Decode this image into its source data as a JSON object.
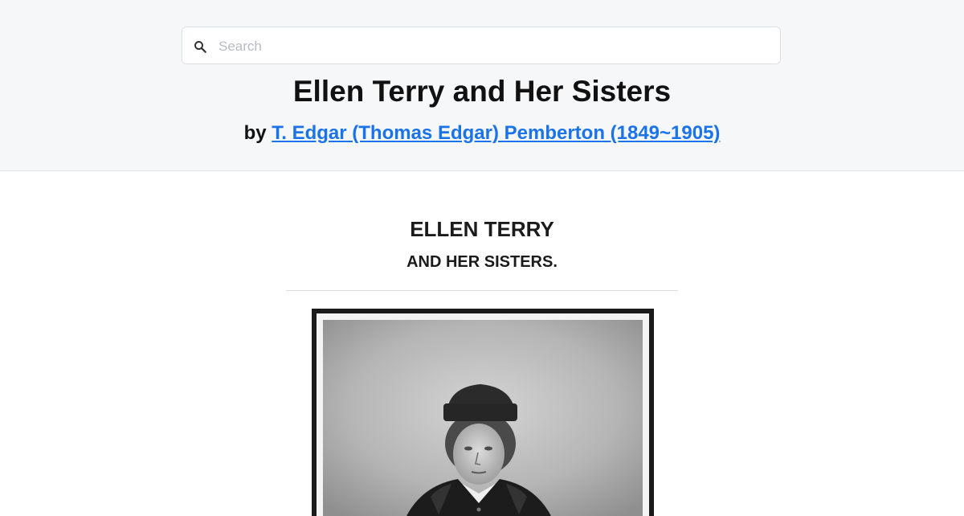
{
  "search": {
    "placeholder": "Search",
    "icon": "search-icon"
  },
  "book": {
    "title": "Ellen Terry and Her Sisters",
    "by_prefix": "by",
    "author": "T. Edgar (Thomas Edgar) Pemberton (1849~1905)"
  },
  "content": {
    "heading": "ELLEN TERRY",
    "subheading": "AND HER SISTERS.",
    "image": "portrait-photo"
  },
  "colors": {
    "header_bg": "#f6f7f9",
    "link": "#1a73e8",
    "text": "#111111"
  }
}
